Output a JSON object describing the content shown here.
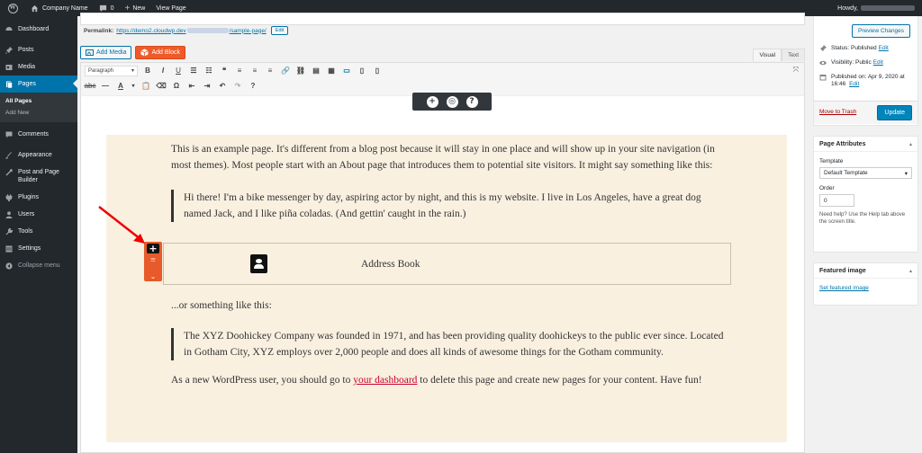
{
  "adminbar": {
    "site_name": "Company Name",
    "comments": "0",
    "new_label": "New",
    "view_page": "View Page",
    "howdy": "Howdy,"
  },
  "sidebar": {
    "items": [
      {
        "label": "Dashboard"
      },
      {
        "label": "Posts"
      },
      {
        "label": "Media"
      },
      {
        "label": "Pages"
      },
      {
        "label": "Comments"
      },
      {
        "label": "Appearance"
      },
      {
        "label": "Post and Page Builder"
      },
      {
        "label": "Plugins"
      },
      {
        "label": "Users"
      },
      {
        "label": "Tools"
      },
      {
        "label": "Settings"
      },
      {
        "label": "Collapse menu"
      }
    ],
    "submenu": [
      "All Pages",
      "Add New"
    ]
  },
  "editor": {
    "permalink_label": "Permalink:",
    "permalink_url": "https://demo2.cloudwp.dev",
    "permalink_slug": "/sample-page/",
    "edit_btn": "Edit",
    "add_media": "Add Media",
    "add_block": "Add Block",
    "tab_visual": "Visual",
    "tab_text": "Text",
    "paragraph_select": "Paragraph"
  },
  "content": {
    "p1": "This is an example page. It's different from a blog post because it will stay in one place and will show up in your site navigation (in most themes). Most people start with an About page that introduces them to potential site visitors. It might say something like this:",
    "q1": "Hi there! I'm a bike messenger by day, aspiring actor by night, and this is my website. I live in Los Angeles, have a great dog named Jack, and I like piña coladas. (And gettin' caught in the rain.)",
    "address_book": "Address Book",
    "p2": "...or something like this:",
    "q2": "The XYZ Doohickey Company was founded in 1971, and has been providing quality doohickeys to the public ever since. Located in Gotham City, XYZ employs over 2,000 people and does all kinds of awesome things for the Gotham community.",
    "p3_a": "As a new WordPress user, you should go to ",
    "p3_link": "your dashboard",
    "p3_b": " to delete this page and create new pages for your content. Have fun!"
  },
  "publish": {
    "preview": "Preview Changes",
    "status_label": "Status:",
    "status_value": "Published",
    "visibility_label": "Visibility:",
    "visibility_value": "Public",
    "published_label": "Published on:",
    "published_value": "Apr 9, 2020 at 16:46",
    "edit": "Edit",
    "trash": "Move to Trash",
    "update": "Update"
  },
  "page_attributes": {
    "title": "Page Attributes",
    "template_label": "Template",
    "template_value": "Default Template",
    "order_label": "Order",
    "order_value": "0",
    "help": "Need help? Use the Help tab above the screen title."
  },
  "featured": {
    "title": "Featured image",
    "link": "Set featured image"
  },
  "colors": {
    "accent": "#0073aa",
    "adminbar": "#23282d",
    "block_orange": "#f05a28",
    "content_bg": "#f9f0e0"
  }
}
